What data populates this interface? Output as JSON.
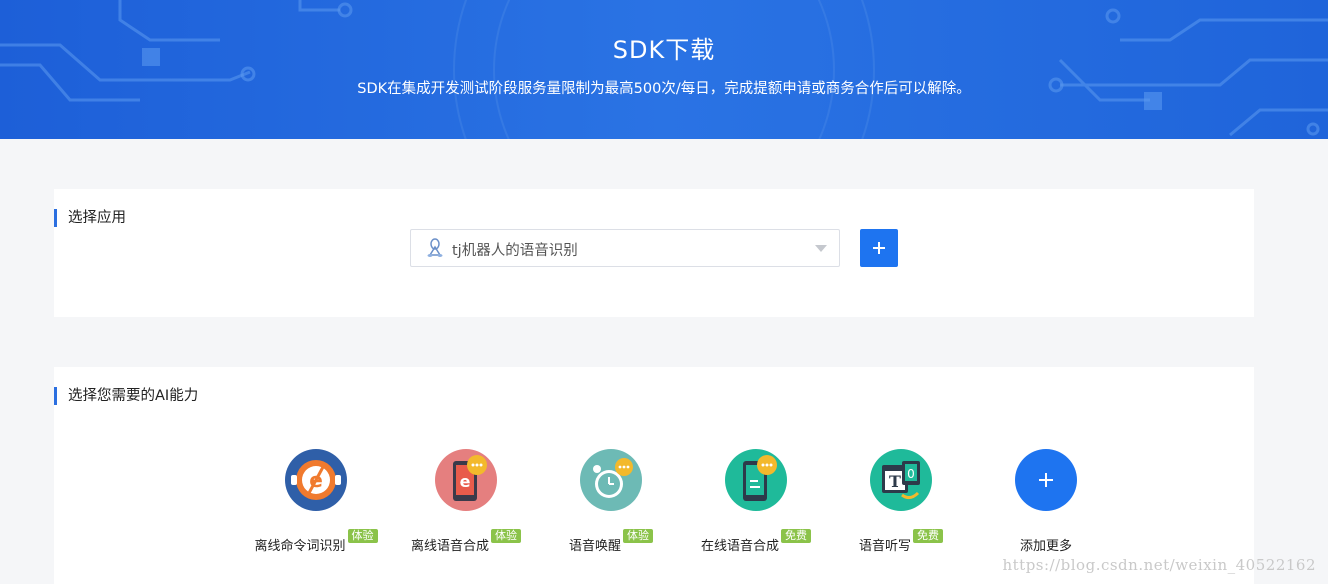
{
  "banner": {
    "title": "SDK下载",
    "subtitle": "SDK在集成开发测试阶段服务量限制为最高500次/每日，完成提额申请或商务合作后可以解除。"
  },
  "select_app": {
    "section_title": "选择应用",
    "selected_value": "tj机器人的语音识别",
    "add_icon": "plus-icon"
  },
  "ai_capabilities": {
    "section_title": "选择您需要的AI能力",
    "items": [
      {
        "label": "离线命令词识别",
        "badge": "体验",
        "icon": "offline-command-icon",
        "color": "#2f5fa8"
      },
      {
        "label": "离线语音合成",
        "badge": "体验",
        "icon": "offline-tts-icon",
        "color": "#e57f7f"
      },
      {
        "label": "语音唤醒",
        "badge": "体验",
        "icon": "wake-alarm-icon",
        "color": "#6dbab5"
      },
      {
        "label": "在线语音合成",
        "badge": "免费",
        "icon": "online-tts-icon",
        "color": "#1fba9a"
      },
      {
        "label": "语音听写",
        "badge": "免费",
        "icon": "dictation-icon",
        "color": "#1fba9a"
      },
      {
        "label": "添加更多",
        "badge": "",
        "icon": "plus-icon",
        "color": "#1e74f0"
      }
    ]
  },
  "watermark": "https://blog.csdn.net/weixin_40522162",
  "colors": {
    "accent": "#1e74f0",
    "badge": "#8bc34a",
    "banner": "#2a73e4"
  }
}
